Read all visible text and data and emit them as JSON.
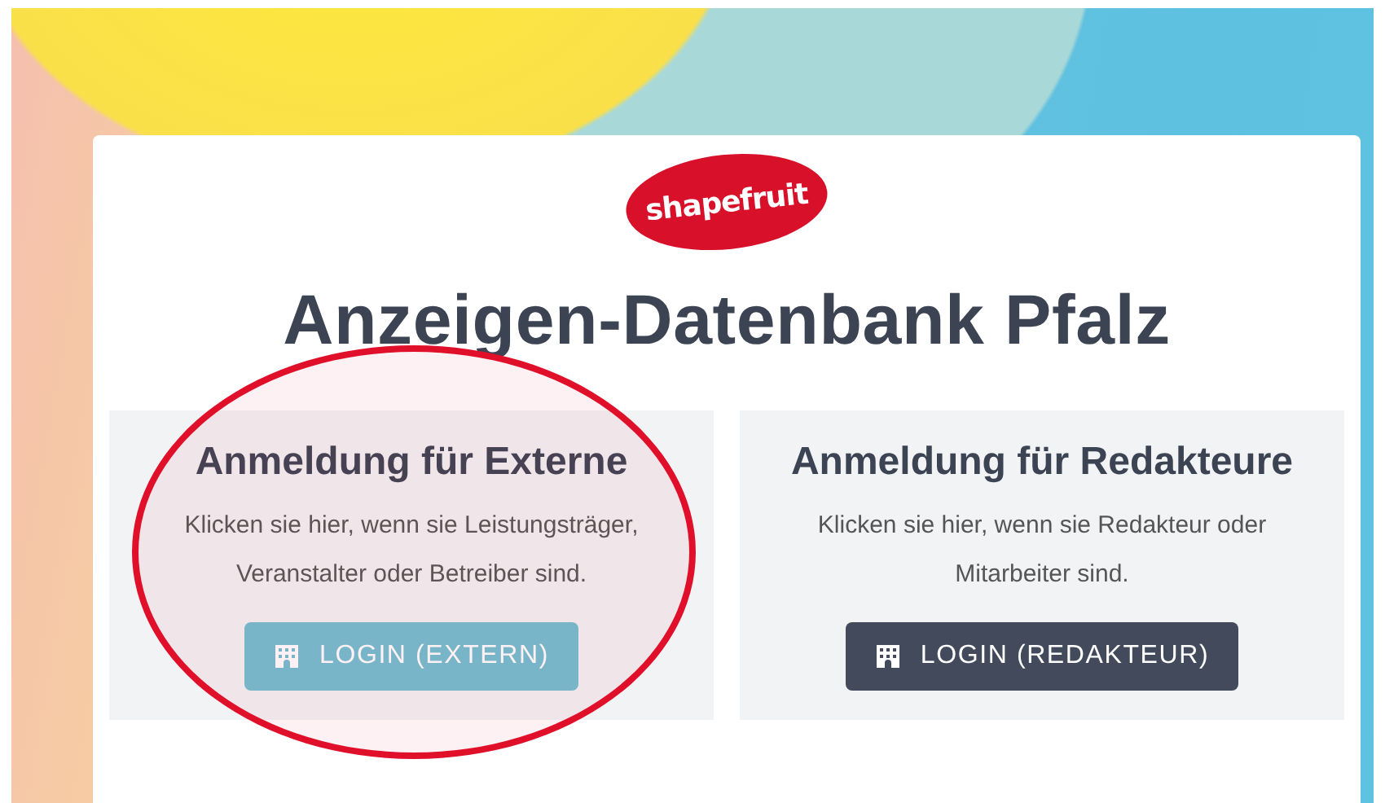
{
  "logo": {
    "text": "shapefruit"
  },
  "title": "Anzeigen-Datenbank Pfalz",
  "panels": [
    {
      "heading": "Anmeldung für Externe",
      "text": "Klicken sie hier, wenn sie Leistungsträger, Veranstalter oder Betreiber sind.",
      "button": {
        "label": "LOGIN (EXTERN)",
        "kind": "info"
      },
      "highlighted": true
    },
    {
      "heading": "Anmeldung für Redakteure",
      "text": "Klicken sie hier, wenn sie Redakteur oder Mitarbeiter sind.",
      "button": {
        "label": "LOGIN (REDAKTEUR)",
        "kind": "dark"
      },
      "highlighted": false
    }
  ]
}
